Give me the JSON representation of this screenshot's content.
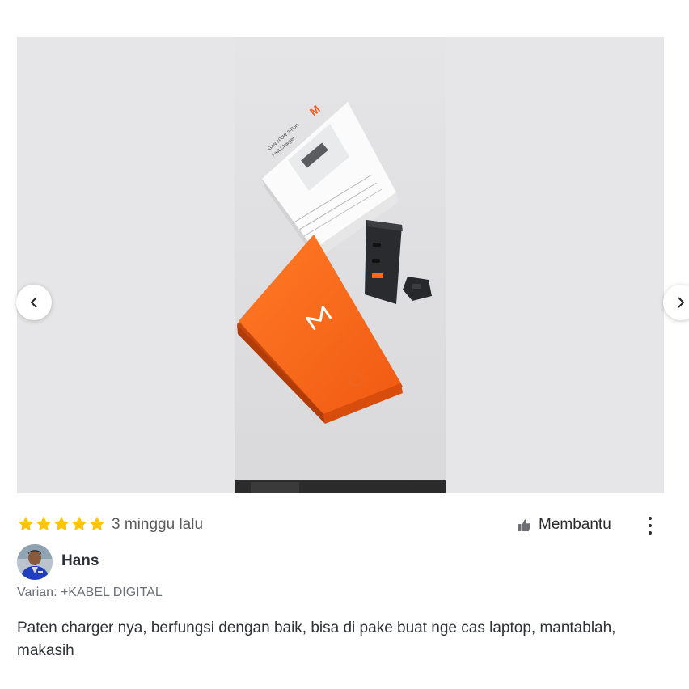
{
  "gallery": {
    "photo_alt": "Foto ulasan produk",
    "prev_icon": "chevron-left-icon",
    "next_icon": "chevron-right-icon",
    "box_print": {
      "line1": "GaN 100W 3-Port",
      "line2": "Fast Charger"
    }
  },
  "review": {
    "rating": 5,
    "rating_max": 5,
    "star_color": "#ffc400",
    "time_ago": "3 minggu lalu",
    "helpful_label": "Membantu",
    "helpful_icon": "thumbs-up-icon",
    "more_icon": "more-vertical-icon",
    "reviewer_name": "Hans",
    "variant": "Varian: +KABEL DIGITAL",
    "text": "Paten charger nya, berfungsi dengan baik, bisa di pake buat nge cas laptop, mantablah, makasih"
  }
}
